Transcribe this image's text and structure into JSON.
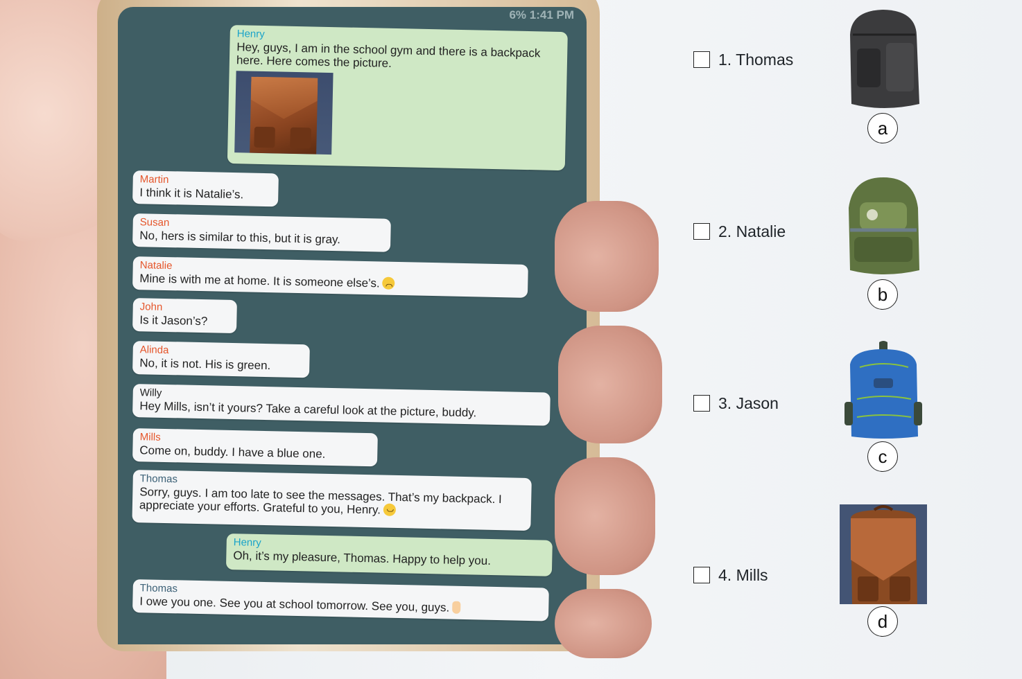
{
  "status_bar": {
    "battery": "6%",
    "time": "1:41 PM"
  },
  "messages": [
    {
      "sender": "Henry",
      "text": "Hey, guys, I am in the school gym and there is a backpack here. Here comes the picture.",
      "own": true
    },
    {
      "sender": "Martin",
      "text": "I think it is Natalie’s."
    },
    {
      "sender": "Susan",
      "text": "No, hers is similar to this, but it is gray."
    },
    {
      "sender": "Natalie",
      "text": "Mine is with me at home. It is someone else’s."
    },
    {
      "sender": "John",
      "text": "Is it Jason’s?"
    },
    {
      "sender": "Alinda",
      "text": "No, it is not. His is green."
    },
    {
      "sender": "Willy",
      "text": "Hey Mills, isn’t it yours? Take a careful look at the picture, buddy."
    },
    {
      "sender": "Mills",
      "text": "Come on, buddy. I have a blue one."
    },
    {
      "sender": "Thomas",
      "text": "Sorry, guys. I am too late to see the messages. That’s my backpack. I appreciate your efforts. Grateful to you, Henry."
    },
    {
      "sender": "Henry",
      "text": "Oh, it’s my pleasure, Thomas. Happy to help you.",
      "own": true
    },
    {
      "sender": "Thomas",
      "text": "I owe you one. See you at school tomorrow. See you, guys."
    }
  ],
  "options": [
    {
      "label": "1. Thomas",
      "letter": "a",
      "bag_color": "#3b3b3d"
    },
    {
      "label": "2. Natalie",
      "letter": "b",
      "bag_color": "#5f7440"
    },
    {
      "label": "3. Jason",
      "letter": "c",
      "bag_color": "#2f6fc2"
    },
    {
      "label": "4. Mills",
      "letter": "d",
      "bag_color": "#8a4a22"
    }
  ],
  "colors": {
    "chat_bg": "#3f5e64",
    "own_bubble": "#cfe8c5",
    "other_bubble": "#f5f6f7"
  }
}
